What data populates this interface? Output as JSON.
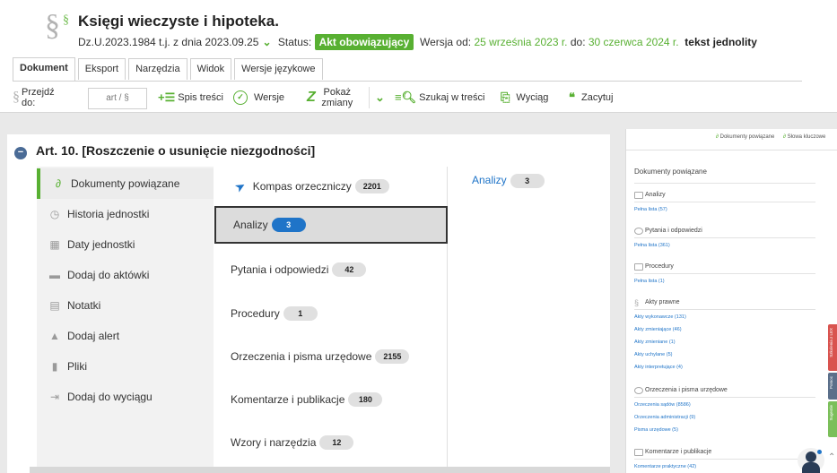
{
  "header": {
    "title": "Księgi wieczyste i hipoteka.",
    "dziennik": "Dz.U.2023.1984 t.j. z dnia 2023.09.25",
    "status_label": "Status:",
    "status_value": "Akt obowiązujący",
    "wersja_label": "Wersja od:",
    "wersja_od": "25 września 2023 r.",
    "do_label": "do:",
    "wersja_do": "30 czerwca 2024 r.",
    "tekst": "tekst jednolity"
  },
  "tabs": [
    "Dokument",
    "Eksport",
    "Narzędzia",
    "Widok",
    "Wersje językowe"
  ],
  "toolbar": {
    "przejdz": "Przejdź do:",
    "art_placeholder": "art / §",
    "spis": "Spis treści",
    "wersje": "Wersje",
    "pokaz_zmiany": "Pokaż zmiany",
    "szukaj": "Szukaj w treści",
    "wyciag": "Wyciąg",
    "zacytuj": "Zacytuj"
  },
  "article": {
    "title": "Art.  10.  [Roszczenie o usunięcie niezgodności]"
  },
  "nav": [
    {
      "label": "Dokumenty powiązane",
      "icon": "link-icon"
    },
    {
      "label": "Historia jednostki",
      "icon": "history-icon"
    },
    {
      "label": "Daty jednostki",
      "icon": "calendar-icon"
    },
    {
      "label": "Dodaj do aktówki",
      "icon": "briefcase-icon"
    },
    {
      "label": "Notatki",
      "icon": "note-icon"
    },
    {
      "label": "Dodaj alert",
      "icon": "bell-icon"
    },
    {
      "label": "Pliki",
      "icon": "file-icon"
    },
    {
      "label": "Dodaj do wyciągu",
      "icon": "extract-icon"
    }
  ],
  "categories": [
    {
      "label": "Kompas orzeczniczy",
      "count": "2201"
    },
    {
      "label": "Analizy",
      "count": "3"
    },
    {
      "label": "Pytania i odpowiedzi",
      "count": "42"
    },
    {
      "label": "Procedury",
      "count": "1"
    },
    {
      "label": "Orzeczenia i pisma urzędowe",
      "count": "2155"
    },
    {
      "label": "Komentarze i publikacje",
      "count": "180"
    },
    {
      "label": "Wzory i narzędzia",
      "count": "12"
    }
  ],
  "detail": {
    "label": "Analizy",
    "count": "3"
  },
  "preview": {
    "tab1": "Dokumenty powiązane",
    "tab2": "Słowa kluczowe",
    "heading": "Dokumenty powiązane",
    "sections": [
      {
        "title": "Analizy",
        "links": [
          "Pełna lista (57)"
        ]
      },
      {
        "title": "Pytania i odpowiedzi",
        "links": [
          "Pełna lista (361)"
        ]
      },
      {
        "title": "Procedury",
        "links": [
          "Pełna lista (1)"
        ]
      },
      {
        "title": "Akty prawne",
        "links": [
          "Akty wykonawcze (131)",
          "Akty zmieniające (46)",
          "Akty zmieniane (1)",
          "Akty uchylane (5)",
          "Akty interpretujące (4)"
        ]
      },
      {
        "title": "Orzeczenia i pisma urzędowe",
        "links": [
          "Orzeczenia sądów (8586)",
          "Orzeczenia administracji (9)",
          "Pisma urzędowe (5)"
        ]
      },
      {
        "title": "Komentarze i publikacje",
        "links": [
          "Komentarze praktyczne (42)"
        ]
      }
    ],
    "side_tabs": [
      "Szkolenia z LEX",
      "Pomoc",
      "Sugestie"
    ]
  },
  "colors": {
    "green": "#58b032",
    "blue": "#1f74c8",
    "navy": "#4a6b96"
  }
}
